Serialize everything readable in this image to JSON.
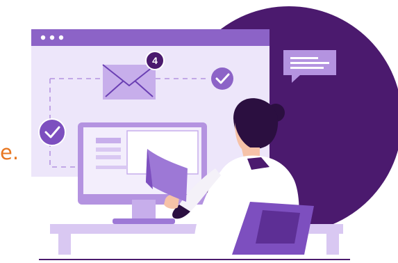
{
  "caption": {
    "text": "e."
  },
  "email": {
    "badge_count": "4"
  },
  "icons": {
    "browser_dots": "window-dots-icon",
    "envelope": "envelope-icon",
    "check": "check-icon",
    "chat": "chat-bubble-icon"
  },
  "colors": {
    "accent_orange": "#e87722",
    "deep_purple": "#4b1a6e",
    "purple": "#7d4fbf",
    "light_purple": "#b493e0",
    "lavender": "#e9e1f8",
    "skin": "#f6c2a8"
  }
}
